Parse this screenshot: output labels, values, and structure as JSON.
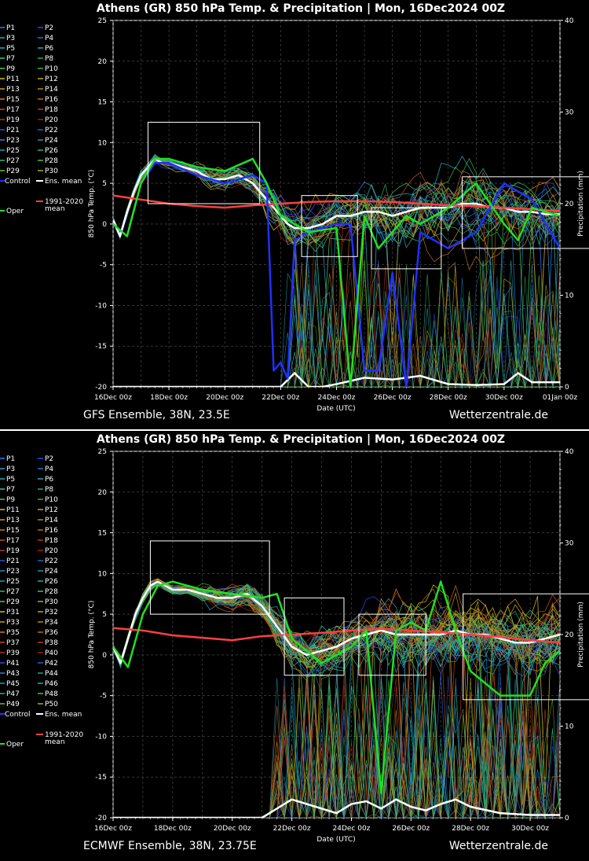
{
  "chart_data": [
    {
      "type": "line",
      "title": "Athens  (GR)  850 hPa Temp. & Precipitation | Mon, 16Dec2024 00Z",
      "xlabel": "Date (UTC)",
      "ylabel": "850 hPa Temp. (°C)",
      "y2label": "Precipitation (mm)",
      "footer_left": "GFS Ensemble, 38N, 23.5E",
      "footer_right": "Wetterzentrale.de",
      "x_ticks": [
        "16Dec 00z",
        "18Dec 00z",
        "20Dec 00z",
        "22Dec 00z",
        "24Dec 00z",
        "26Dec 00z",
        "28Dec 00z",
        "30Dec 00z",
        "01Jan 00z"
      ],
      "xlim_days": 16,
      "ylim": [
        -20,
        25
      ],
      "y_ticks": [
        "25",
        "20",
        "15",
        "10",
        "5",
        "0",
        "-5",
        "-10",
        "-15",
        "-20"
      ],
      "y2lim": [
        0,
        40
      ],
      "y2_ticks": [
        "40",
        "30",
        "20",
        "10",
        "0"
      ],
      "grid": true,
      "legend": [
        "P1",
        "P2",
        "P3",
        "P4",
        "P5",
        "P6",
        "P7",
        "P8",
        "P9",
        "P10",
        "P11",
        "P12",
        "P13",
        "P14",
        "P15",
        "P16",
        "P17",
        "P18",
        "P19",
        "P20",
        "P21",
        "P22",
        "P23",
        "P24",
        "P25",
        "P26",
        "P27",
        "P28",
        "P29",
        "P30",
        "Control",
        "Ens. mean",
        "1991-2020",
        "mean",
        "Oper"
      ],
      "legend_colors": [
        "#3a7bff",
        "#1f4fff",
        "#2aa0c8",
        "#1e7ad0",
        "#20b0b8",
        "#2f9fb0",
        "#30c890",
        "#20a870",
        "#48c840",
        "#3ab02a",
        "#d0c020",
        "#c0a818",
        "#d09820",
        "#b88a18",
        "#d07a20",
        "#b86a18",
        "#c05020",
        "#b04018",
        "#b83030",
        "#a02020",
        "#3050c8",
        "#1f68c0",
        "#2a88c0",
        "#2098a8",
        "#20a0b0",
        "#28b090",
        "#30b878",
        "#40c060",
        "#58c830",
        "#a8b020"
      ],
      "series": [
        {
          "name": "Ens. mean",
          "color": "#ffffff",
          "x": [
            0,
            0.25,
            0.5,
            0.75,
            1,
            1.25,
            1.5,
            1.75,
            2,
            2.5,
            3,
            3.5,
            4,
            4.5,
            5,
            5.5,
            6,
            6.25,
            6.5,
            6.75,
            7,
            7.5,
            8,
            8.5,
            9,
            9.5,
            10,
            10.5,
            11,
            11.5,
            12,
            12.5,
            13,
            13.5,
            14,
            14.5,
            15,
            15.5,
            16
          ],
          "y": [
            0.5,
            -1.5,
            1.5,
            4,
            6,
            7,
            8,
            7.5,
            7.5,
            7,
            6.5,
            5.5,
            5.5,
            6,
            5,
            3,
            1,
            0,
            -0.5,
            -0.5,
            -0.5,
            0,
            1,
            1,
            1.5,
            1.5,
            1,
            1.5,
            2,
            2,
            2,
            2.5,
            2.5,
            2,
            2,
            1.5,
            1.5,
            1.2,
            1.2
          ]
        },
        {
          "name": "1991-2020 mean",
          "color": "#ff4040",
          "x": [
            0,
            1,
            2,
            3,
            4,
            5,
            6,
            7,
            8,
            9,
            10,
            11,
            12,
            13,
            14,
            15,
            16
          ],
          "y": [
            3.5,
            3,
            2.5,
            2.2,
            2,
            2.3,
            2.5,
            2.7,
            2.8,
            2.8,
            2.7,
            2.5,
            2.3,
            2.2,
            2,
            1.8,
            1.6
          ]
        },
        {
          "name": "Control",
          "color": "#2030ff",
          "x": [
            0,
            0.5,
            1,
            1.5,
            2,
            3,
            4,
            5,
            5.5,
            5.75,
            6,
            6.25,
            6.5,
            7,
            8,
            8.5,
            9,
            9.5,
            10,
            10.5,
            11,
            12,
            13,
            14,
            15,
            16
          ],
          "y": [
            0,
            -1.5,
            5,
            7.5,
            7.5,
            6,
            5,
            6,
            5,
            -18,
            -17,
            -19,
            -2,
            -1,
            0,
            0,
            -18,
            -18,
            -6,
            -20,
            -1,
            -3,
            -1,
            5,
            3,
            -3
          ]
        },
        {
          "name": "Oper",
          "color": "#20e020",
          "x": [
            0,
            0.5,
            1,
            1.5,
            2,
            3,
            4,
            5,
            5.5,
            6,
            7,
            8,
            8.5,
            9,
            9.5,
            10,
            10.5,
            11,
            12,
            13,
            14,
            14.5,
            15,
            16
          ],
          "y": [
            0,
            -1.5,
            5,
            8,
            8,
            7,
            6.5,
            8,
            5,
            1,
            -1,
            -0.5,
            -20,
            1,
            -3,
            -1,
            1,
            0,
            2,
            5,
            0,
            -2,
            2,
            1
          ]
        }
      ],
      "boxes": [
        {
          "x": [
            1.25,
            5.25
          ],
          "y": [
            2.5,
            12.5
          ]
        },
        {
          "x": [
            6.75,
            8.75
          ],
          "y": [
            -4,
            3.5
          ]
        },
        {
          "x": [
            9.25,
            11.75
          ],
          "y": [
            -5.5,
            2
          ]
        },
        {
          "x": [
            12.5,
            18.6
          ],
          "y": [
            -3,
            5.8
          ]
        }
      ],
      "precip_mean": {
        "x": [
          0,
          6,
          6.5,
          7,
          7.5,
          8,
          9,
          10,
          11,
          12,
          13,
          14,
          14.5,
          15,
          16
        ],
        "y": [
          0,
          0,
          1.5,
          0,
          0,
          0.3,
          1,
          0.8,
          1.2,
          0.3,
          0.2,
          0.3,
          1.5,
          0.5,
          0.5
        ]
      }
    },
    {
      "type": "line",
      "title": "Athens  (GR)  850 hPa Temp. & Precipitation | Mon, 16Dec2024 00Z",
      "xlabel": "Date (UTC)",
      "ylabel": "850 hPa Temp. (°C)",
      "y2label": "Precipitation (mm)",
      "footer_left": "ECMWF Ensemble, 38N, 23.75E",
      "footer_right": "Wetterzentrale.de",
      "x_ticks": [
        "16Dec 00z",
        "18Dec 00z",
        "20Dec 00z",
        "22Dec 00z",
        "24Dec 00z",
        "26Dec 00z",
        "28Dec 00z",
        "30Dec 00z"
      ],
      "xlim_days": 15,
      "ylim": [
        -20,
        25
      ],
      "y_ticks": [
        "25",
        "20",
        "15",
        "10",
        "5",
        "0",
        "-5",
        "-10",
        "-15",
        "-20"
      ],
      "y2lim": [
        0,
        40
      ],
      "y2_ticks": [
        "40",
        "30",
        "20",
        "10",
        "0"
      ],
      "grid": true,
      "legend": [
        "P1",
        "P2",
        "P3",
        "P4",
        "P5",
        "P6",
        "P7",
        "P8",
        "P9",
        "P10",
        "P11",
        "P12",
        "P13",
        "P14",
        "P15",
        "P16",
        "P17",
        "P18",
        "P19",
        "P20",
        "P21",
        "P22",
        "P23",
        "P24",
        "P25",
        "P26",
        "P27",
        "P28",
        "P29",
        "P30",
        "P31",
        "P32",
        "P33",
        "P34",
        "P35",
        "P36",
        "P37",
        "P38",
        "P39",
        "P40",
        "P41",
        "P42",
        "P43",
        "P44",
        "P45",
        "P46",
        "P47",
        "P48",
        "P49",
        "P50",
        "Control",
        "Ens. mean",
        "1991-2020",
        "mean",
        "Oper"
      ],
      "legend_colors": [
        "#3a7bff",
        "#1f4fff",
        "#2aa0c8",
        "#1e7ad0",
        "#20b0b8",
        "#2f9fb0",
        "#30c890",
        "#20a870",
        "#48c840",
        "#3ab02a",
        "#d0c020",
        "#c0a818",
        "#d09820",
        "#b88a18",
        "#d07a20",
        "#b86a18",
        "#c05020",
        "#b04018",
        "#b83030",
        "#a02020",
        "#3050c8",
        "#1f68c0",
        "#2a88c0",
        "#2098a8",
        "#20a0b0",
        "#28b090",
        "#30b878",
        "#40c060",
        "#58c830",
        "#a8b020",
        "#d0c020",
        "#c0a818",
        "#d09820",
        "#b88a18",
        "#d07a20",
        "#b86a18",
        "#c05020",
        "#b04018",
        "#b83030",
        "#a02020",
        "#3050c8",
        "#1f68c0",
        "#2a88c0",
        "#2098a8",
        "#20a0b0",
        "#28b090",
        "#30b878",
        "#40c060",
        "#58c830",
        "#a8b020"
      ],
      "series": [
        {
          "name": "Ens. mean",
          "color": "#ffffff",
          "x": [
            0,
            0.25,
            0.5,
            0.75,
            1,
            1.25,
            1.5,
            1.75,
            2,
            2.5,
            3,
            3.5,
            4,
            4.5,
            5,
            5.5,
            6,
            6.5,
            7,
            7.5,
            8,
            8.5,
            9,
            9.5,
            10,
            10.5,
            11,
            11.5,
            12,
            12.5,
            13,
            13.5,
            14,
            14.5,
            15
          ],
          "y": [
            1,
            -1,
            2,
            5,
            7,
            8.5,
            9,
            8.5,
            8,
            8,
            7.5,
            7,
            7,
            7.5,
            6,
            3.5,
            1,
            0,
            0.5,
            1,
            2,
            2.5,
            3,
            2.5,
            2.5,
            2.5,
            2.5,
            3,
            2.5,
            2.5,
            2,
            1.5,
            1.5,
            2,
            2.5
          ]
        },
        {
          "name": "1991-2020 mean",
          "color": "#ff4040",
          "x": [
            0,
            1,
            2,
            3,
            4,
            5,
            6,
            7,
            8,
            9,
            10,
            11,
            12,
            13,
            14,
            15
          ],
          "y": [
            3.3,
            3,
            2.4,
            2.1,
            1.8,
            2.3,
            2.5,
            2.7,
            3,
            3.2,
            3,
            2.8,
            2.5,
            2.2,
            1.8,
            1.5
          ]
        },
        {
          "name": "Oper",
          "color": "#20e020",
          "x": [
            0,
            0.5,
            1,
            1.5,
            2,
            3,
            4,
            5,
            5.5,
            6,
            7,
            8,
            8.5,
            9,
            9.5,
            10,
            10.5,
            11,
            11.5,
            12,
            13,
            14,
            14.5,
            15
          ],
          "y": [
            1,
            -1.5,
            5,
            8.5,
            9,
            8,
            7.5,
            7,
            7.5,
            2,
            -1,
            1,
            3,
            -17,
            3,
            4,
            3,
            9,
            3,
            -2,
            -5,
            -5,
            -1,
            0.5
          ]
        }
      ],
      "boxes": [
        {
          "x": [
            1.25,
            5.25
          ],
          "y": [
            5,
            14
          ]
        },
        {
          "x": [
            5.75,
            7.75
          ],
          "y": [
            -2.5,
            7
          ]
        },
        {
          "x": [
            8.25,
            10.5
          ],
          "y": [
            -2.5,
            5
          ]
        },
        {
          "x": [
            11.75,
            16.25
          ],
          "y": [
            -5.5,
            7.5
          ]
        }
      ],
      "precip_mean": {
        "x": [
          0,
          5,
          5.5,
          6,
          6.5,
          7,
          7.5,
          8,
          8.5,
          9,
          9.5,
          10,
          10.5,
          11,
          11.5,
          12,
          13,
          14,
          15
        ],
        "y": [
          0,
          0,
          1,
          2,
          1.5,
          1,
          0.5,
          1.5,
          1.8,
          1,
          2,
          1.2,
          0.8,
          1.5,
          2,
          1.2,
          0.5,
          0.3,
          0.3
        ]
      }
    }
  ]
}
